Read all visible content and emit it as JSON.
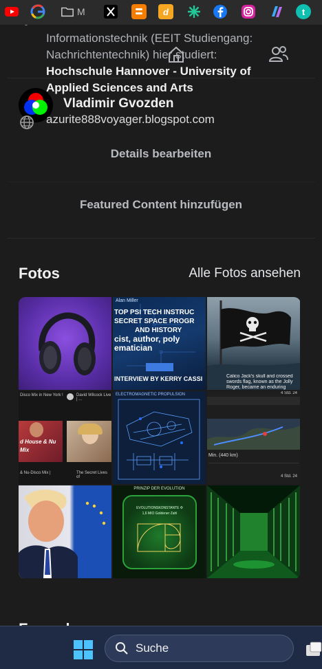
{
  "bookmarks": [
    {
      "name": "youtube",
      "color": "#ff0000"
    },
    {
      "name": "google",
      "color": "#4285f4"
    },
    {
      "name": "folder",
      "color": "#d0d0d0",
      "label": "M"
    },
    {
      "name": "x-twitter",
      "color": "#000000"
    },
    {
      "name": "blogger",
      "color": "#f57d00"
    },
    {
      "name": "dict",
      "color": "#f5a623",
      "label": "d"
    },
    {
      "name": "perplexity",
      "color": "#20c997"
    },
    {
      "name": "facebook",
      "color": "#1877f2"
    },
    {
      "name": "instagram",
      "color": "#e1306c"
    },
    {
      "name": "copilot",
      "color": "#5b6cf0"
    },
    {
      "name": "tumblr",
      "color": "#0fbfb0",
      "label": "t"
    }
  ],
  "intro": {
    "line_prefix": "Informationstechnik (EEIT Studiengang: Nachrichtentechnik) hier studiert: ",
    "school": "Hochschule Hannover - University of Applied Sciences and Arts"
  },
  "profile": {
    "name": "Vladimir Gvozden",
    "blog": "azurite888voyager.blogspot.com"
  },
  "actions": {
    "edit_details": "Details bearbeiten",
    "add_featured": "Featured Content hinzufügen"
  },
  "photos": {
    "title": "Fotos",
    "see_all": "Alle Fotos ansehen",
    "tile2_lines": [
      "TOP PSI TECH INSTRUC",
      "SECRET SPACE PROGR",
      "AND HISTORY",
      "cist, author, poly",
      "ematician",
      "INTERVIEW BY KERRY CASSI"
    ],
    "tile2_header": "Alan Miller",
    "tile3_caption": "Calico Jack's skull and crossed swords flag, known as the Jolly Roger, became an enduring symbol of piracy. His design was",
    "tile4_items": [
      "Disco Mix in New York !",
      "David Wilcock Live | ...",
      "d House & Nu",
      "Mix",
      "& Nu-Disco Mix |",
      "The Secret Lives of"
    ],
    "tile5_header": "ELECTROMAGNETIC PROPULSION",
    "tile6_text": [
      "Min. (440 km)",
      "4 Std. 24"
    ],
    "tile8_lines": [
      "PRINZIP DER EVOLUTION",
      "EVOLUTIONSKONSTANTE Φ",
      "1,6 MIO Goldener Zahl"
    ]
  },
  "next_section": "Freunde",
  "taskbar": {
    "search_label": "Suche"
  }
}
